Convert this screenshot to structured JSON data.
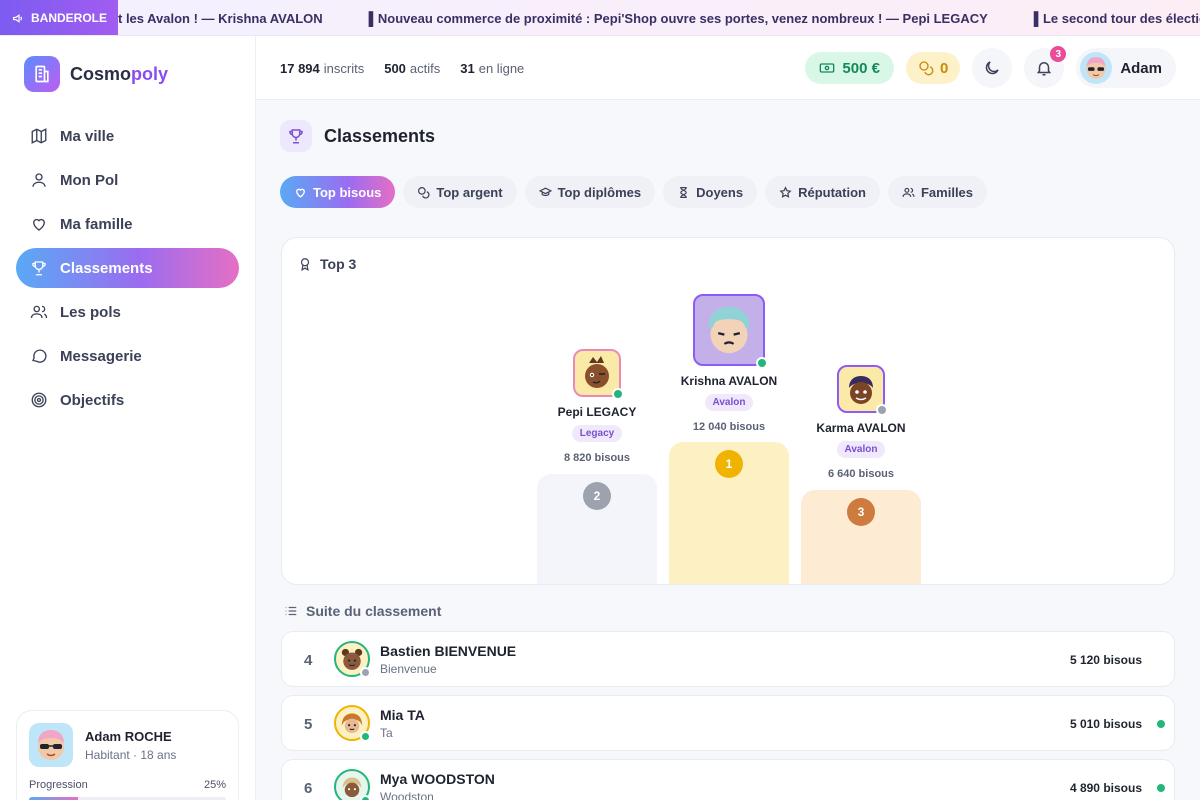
{
  "ticker": {
    "badge": "BANDEROLE",
    "items": [
      "t les Avalon ! — Krishna AVALON",
      "▌Nouveau commerce de proximité : Pepi'Shop ouvre ses portes, venez nombreux ! — Pepi LEGACY",
      "▌Le second tour des élections est en co"
    ]
  },
  "brand": {
    "prefix": "Cosmo",
    "suffix": "poly"
  },
  "nav": [
    {
      "label": "Ma ville",
      "icon": "map-icon"
    },
    {
      "label": "Mon Pol",
      "icon": "user-icon"
    },
    {
      "label": "Ma famille",
      "icon": "heart-icon"
    },
    {
      "label": "Classements",
      "icon": "trophy-icon",
      "active": true
    },
    {
      "label": "Les pols",
      "icon": "users-icon"
    },
    {
      "label": "Messagerie",
      "icon": "message-icon"
    },
    {
      "label": "Objectifs",
      "icon": "target-icon"
    }
  ],
  "user_card": {
    "name": "Adam ROCHE",
    "subtitle": "Habitant · 18 ans",
    "progress_label": "Progression",
    "progress_text": "25%",
    "progress_value": 0.25
  },
  "header": {
    "stats": [
      {
        "value": "17 894",
        "label": "inscrits"
      },
      {
        "value": "500",
        "label": "actifs"
      },
      {
        "value": "31",
        "label": "en ligne"
      }
    ],
    "money": "500 €",
    "coins": "0",
    "notifications": "3",
    "username": "Adam"
  },
  "page": {
    "title": "Classements"
  },
  "tabs": [
    {
      "label": "Top bisous",
      "icon": "heart-icon",
      "active": true
    },
    {
      "label": "Top argent",
      "icon": "coins-icon"
    },
    {
      "label": "Top diplômes",
      "icon": "graduation-cap-icon"
    },
    {
      "label": "Doyens",
      "icon": "hourglass-icon"
    },
    {
      "label": "Réputation",
      "icon": "star-icon"
    },
    {
      "label": "Familles",
      "icon": "users-icon"
    }
  ],
  "podium": {
    "title": "Top 3",
    "players": [
      {
        "rank": "2",
        "name": "Pepi LEGACY",
        "family": "Legacy",
        "score": "8 820 bisous",
        "online": true
      },
      {
        "rank": "1",
        "name": "Krishna AVALON",
        "family": "Avalon",
        "score": "12 040 bisous",
        "online": true
      },
      {
        "rank": "3",
        "name": "Karma AVALON",
        "family": "Avalon",
        "score": "6 640 bisous",
        "online": false
      }
    ]
  },
  "suite": {
    "title": "Suite du classement",
    "rows": [
      {
        "rank": "4",
        "name": "Bastien BIENVENUE",
        "family": "Bienvenue",
        "score": "5 120 bisous",
        "online": false
      },
      {
        "rank": "5",
        "name": "Mia TA",
        "family": "Ta",
        "score": "5 010 bisous",
        "online": true
      },
      {
        "rank": "6",
        "name": "Mya WOODSTON",
        "family": "Woodston",
        "score": "4 890 bisous",
        "online": true
      }
    ]
  },
  "colors": {
    "accent": "#9b6cf0",
    "gold": "#f0b400",
    "silver": "#9ca3af",
    "bronze": "#cf7a3e",
    "online": "#22b67a",
    "money": "#138a55"
  }
}
